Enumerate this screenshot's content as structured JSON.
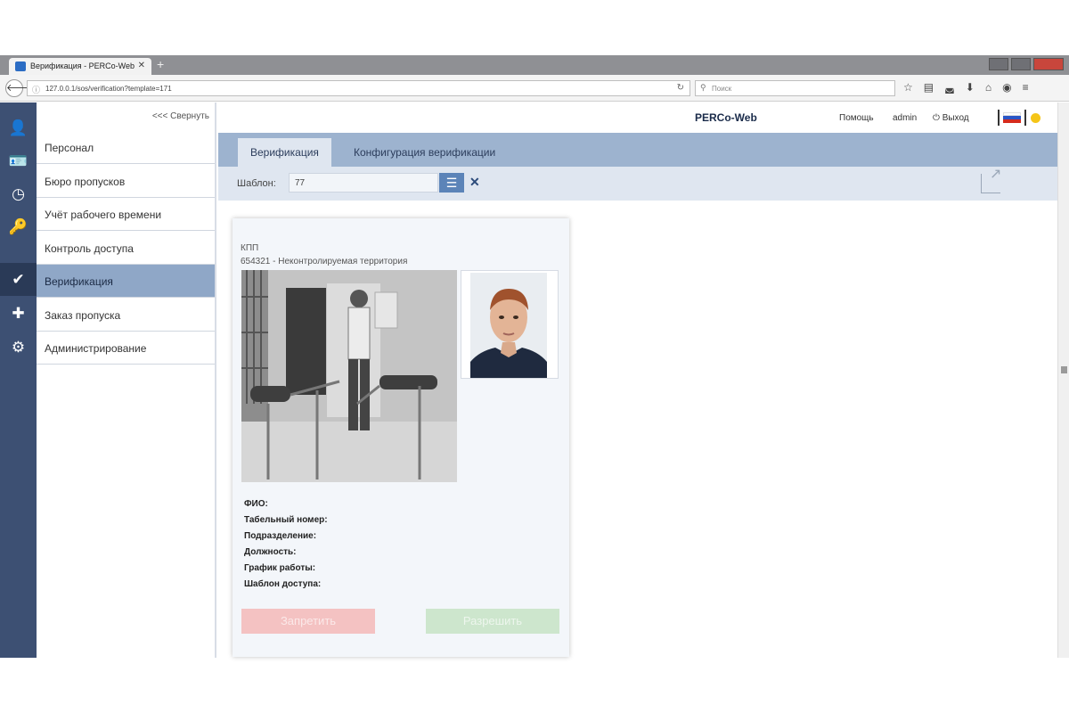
{
  "browser": {
    "tab_title": "Верификация - PERCo-Web",
    "tab_close": "✕",
    "new_tab": "+",
    "url": "127.0.0.1/sos/verification?template=171",
    "search_placeholder": "Поиск"
  },
  "sidebar": {
    "collapse_label": "<<< Свернуть",
    "items": [
      {
        "label": "Персонал",
        "icon": "personnel-icon"
      },
      {
        "label": "Бюро пропусков",
        "icon": "pass-office-icon"
      },
      {
        "label": "Учёт рабочего времени",
        "icon": "time-tracking-icon"
      },
      {
        "label": "Контроль доступа",
        "icon": "key-icon"
      },
      {
        "label": "Верификация",
        "icon": "verification-icon",
        "active": true
      },
      {
        "label": "Заказ пропуска",
        "icon": "order-pass-icon"
      },
      {
        "label": "Администрирование",
        "icon": "gear-icon"
      }
    ]
  },
  "header": {
    "brand": "PERCo-Web",
    "help": "Помощь",
    "user": "admin",
    "logout": "Выход"
  },
  "tabs": [
    "Верификация",
    "Конфигурация верификации"
  ],
  "filter": {
    "label": "Шаблон:",
    "value": "77"
  },
  "card": {
    "title": "КПП",
    "subtitle": "654321 - Неконтролируемая территория",
    "fields": [
      "ФИО:",
      "Табельный номер:",
      "Подразделение:",
      "Должность:",
      "График работы:",
      "Шаблон доступа:"
    ],
    "deny_label": "Запретить",
    "allow_label": "Разрешить"
  },
  "colors": {
    "rail": "#3d5073",
    "active_menu": "#8fa7c7",
    "tabs_bar": "#9db3cf",
    "deny": "#f4c2c2",
    "allow": "#cde6cd"
  }
}
